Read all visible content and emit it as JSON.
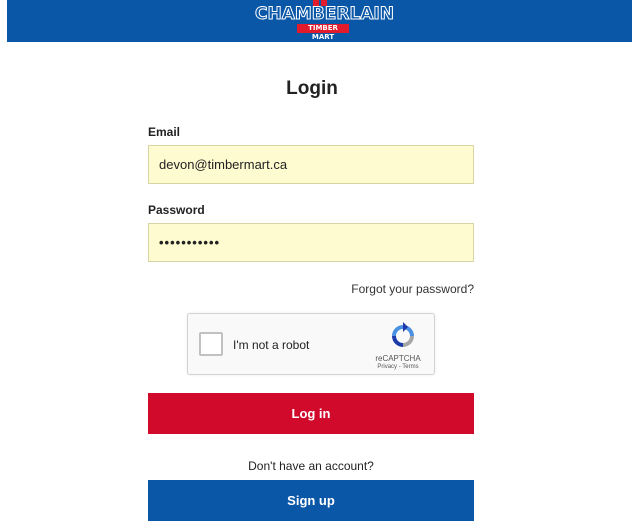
{
  "header": {
    "logo_brand": "CHAMBERLAIN",
    "logo_sub": "TIMBER MART",
    "brand_colors": {
      "primary_blue": "#0a57a8",
      "accent_red": "#e11b2c"
    }
  },
  "form": {
    "title": "Login",
    "email_label": "Email",
    "email_value": "devon@timbermart.ca",
    "password_label": "Password",
    "password_value": "•••••••••••",
    "forgot_link": "Forgot your password?",
    "captcha": {
      "checkbox_label": "I'm not a robot",
      "brand": "reCAPTCHA",
      "links": "Privacy - Terms"
    },
    "login_button": "Log in",
    "no_account_text": "Don't have an account?",
    "signup_button": "Sign up"
  }
}
